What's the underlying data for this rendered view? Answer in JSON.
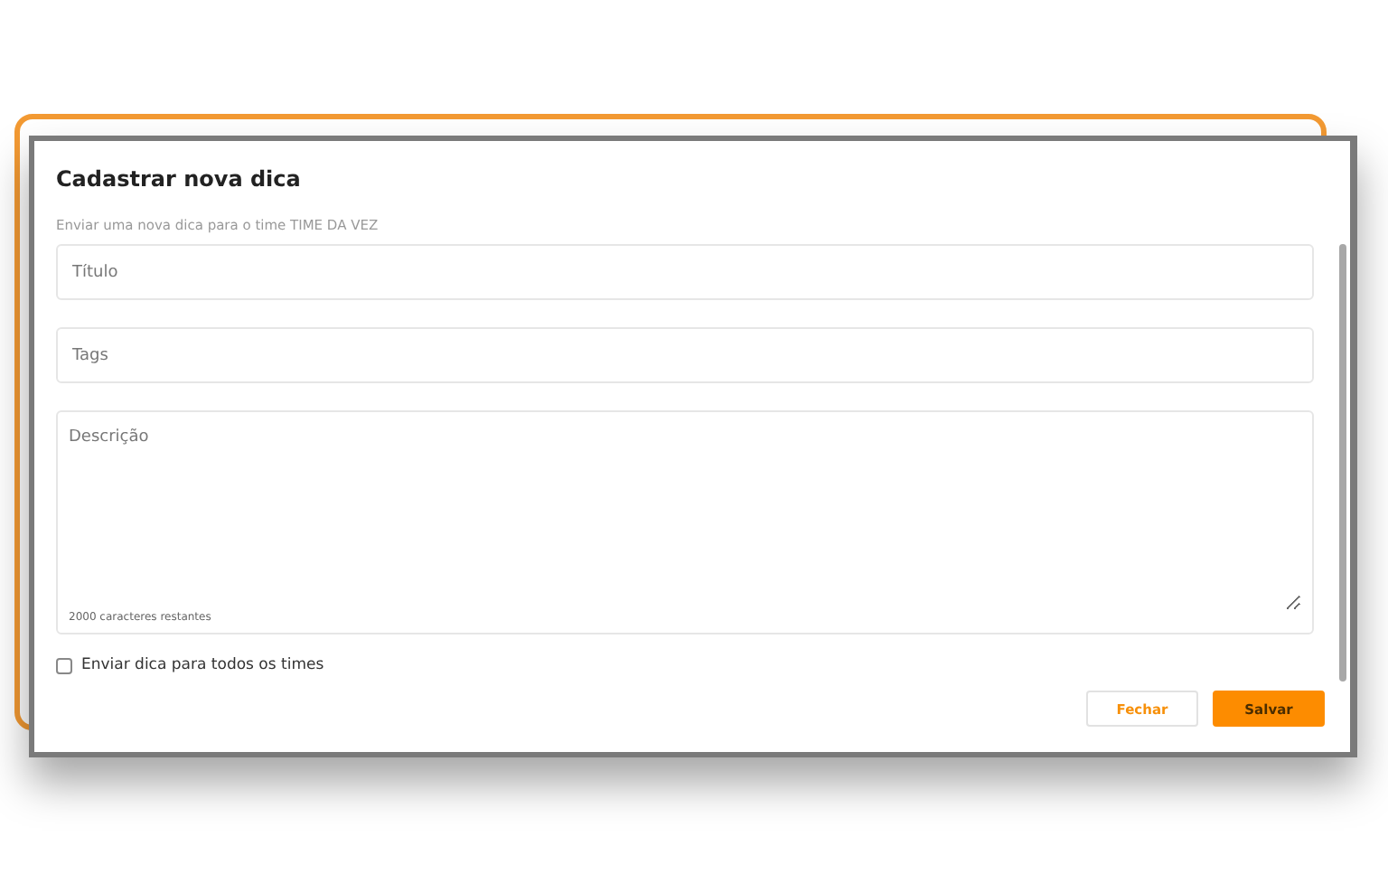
{
  "dialog": {
    "title": "Cadastrar nova dica",
    "subtitle": "Enviar uma nova dica para o time TIME DA VEZ",
    "fields": [
      {
        "kind": "input",
        "placeholder": "Título"
      },
      {
        "kind": "input",
        "placeholder": "Tags"
      },
      {
        "kind": "textarea",
        "placeholder": "Descrição",
        "counter": "2000 caracteres restantes"
      }
    ],
    "checkbox": {
      "label": "Enviar dica para todos os times",
      "checked": false
    },
    "buttons": [
      {
        "label": "Fechar",
        "kind": "secondary"
      },
      {
        "label": "Salvar",
        "kind": "primary"
      }
    ]
  }
}
